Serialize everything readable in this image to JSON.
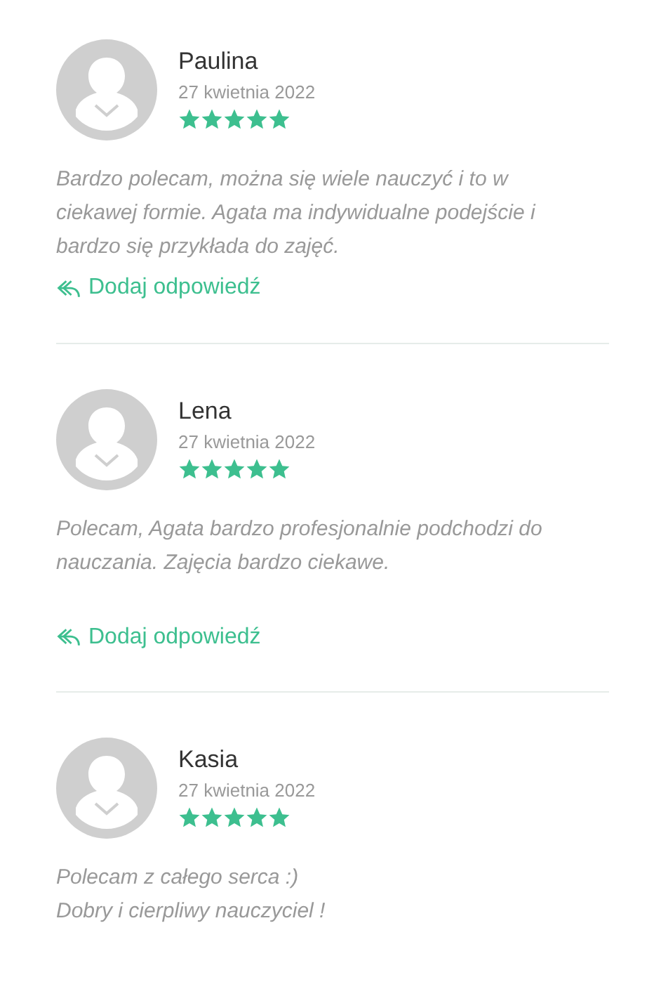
{
  "reviews": [
    {
      "name": "Paulina",
      "date": "27 kwietnia 2022",
      "stars": 5,
      "text": "Bardzo polecam, można się wiele nauczyć i to w\nciekawej formie. Agata ma indywidualne podejście i\nbardzo się przykłada do zajęć.",
      "reply": "Dodaj odpowiedź"
    },
    {
      "name": "Lena",
      "date": "27 kwietnia 2022",
      "stars": 5,
      "text": "Polecam, Agata bardzo profesjonalnie podchodzi do\nnauczania. Zajęcia bardzo ciekawe.",
      "reply": "Dodaj odpowiedź"
    },
    {
      "name": "Kasia",
      "date": "27 kwietnia 2022",
      "stars": 5,
      "text": "Polecam z całego serca :)\nDobry i cierpliwy nauczyciel !"
    }
  ]
}
